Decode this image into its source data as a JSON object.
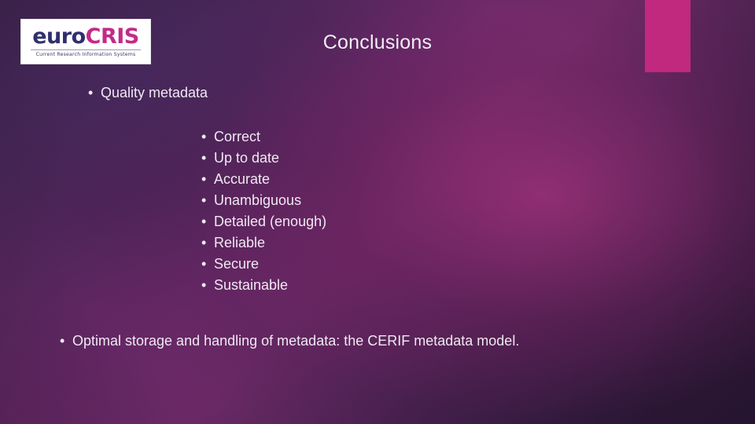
{
  "slide": {
    "title": "Conclusions",
    "logo": {
      "word_euro": "euro",
      "word_cris": "CRIS",
      "tagline": "Current Research Information Systems"
    },
    "bullet_marker": "•",
    "level1_item": "Quality metadata",
    "sub_items": [
      "Correct",
      "Up to date",
      "Accurate",
      "Unambiguous",
      "Detailed (enough)",
      "Reliable",
      "Secure",
      "Sustainable"
    ],
    "closing_item": "Optimal storage and handling of metadata: the CERIF metadata model.",
    "colors": {
      "accent_block": "#c0297d",
      "text": "#efe9f2",
      "logo_euro": "#2f2f6e",
      "logo_cris": "#c32a87"
    }
  }
}
